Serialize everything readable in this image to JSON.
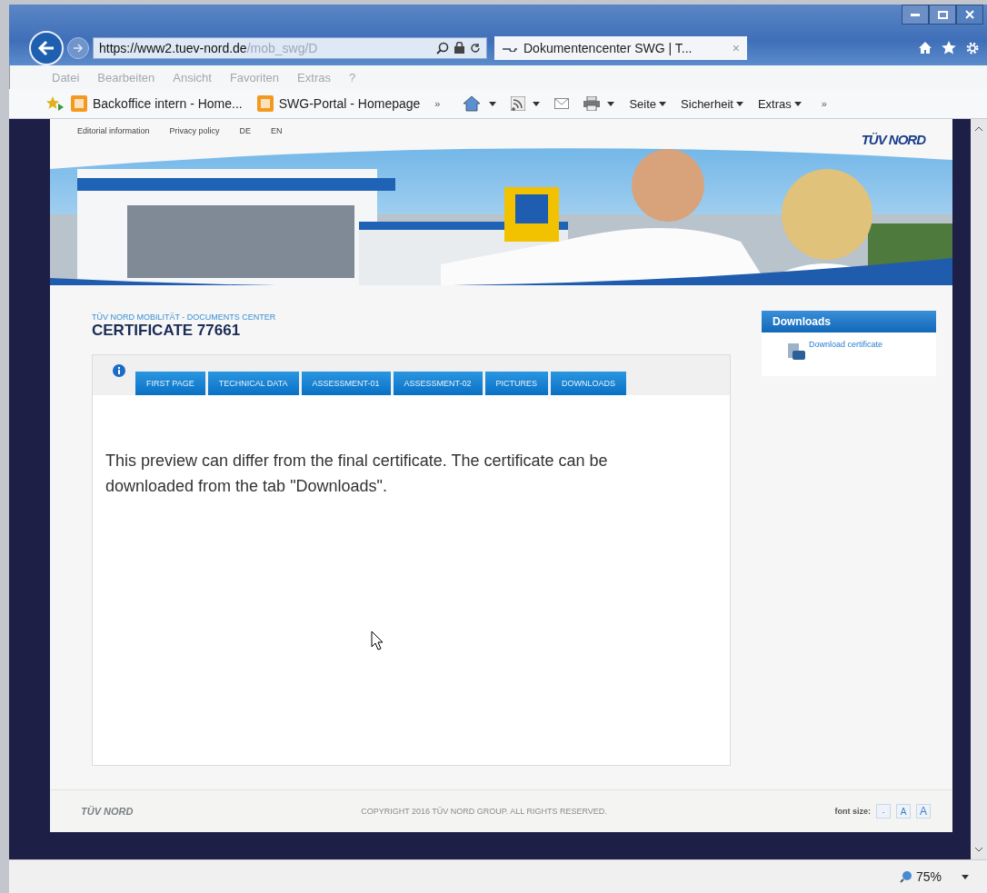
{
  "browser": {
    "address": {
      "scheme": "https://www2.",
      "domain": "tuev-nord.de",
      "path": "/mob_swg/D"
    },
    "tab": {
      "title": "Dokumentencenter SWG | T...",
      "close": "×"
    },
    "menu": [
      "Datei",
      "Bearbeiten",
      "Ansicht",
      "Favoriten",
      "Extras",
      "?"
    ],
    "favorites": [
      "Backoffice intern - Home...",
      "SWG-Portal - Homepage"
    ],
    "favorites_more": "»",
    "commands": [
      "Seite",
      "Sicherheit",
      "Extras"
    ],
    "commands_more": "»",
    "zoom": "75%"
  },
  "page": {
    "top_links": [
      "Editorial information",
      "Privacy policy",
      "DE",
      "EN"
    ],
    "logo": "TÜV NORD",
    "breadcrumb": "TÜV NORD MOBILITÄT - DOCUMENTS CENTER",
    "title": "CERTIFICATE 77661",
    "tabs": [
      {
        "kind": "info",
        "selected": true
      },
      {
        "kind": "text",
        "label": "FIRST PAGE",
        "selected": false
      },
      {
        "kind": "text",
        "label": "TECHNICAL DATA",
        "selected": false
      },
      {
        "kind": "text",
        "label": "ASSESSMENT-01",
        "selected": false
      },
      {
        "kind": "text",
        "label": "ASSESSMENT-02",
        "selected": false
      },
      {
        "kind": "text",
        "label": "PICTURES",
        "selected": false
      },
      {
        "kind": "text",
        "label": "DOWNLOADS",
        "selected": false
      }
    ],
    "notice": "This preview can differ from the final certificate. The certificate can be downloaded from the tab \"Downloads\".",
    "sidebar": {
      "title": "Downloads",
      "links": [
        "Download certificate"
      ]
    },
    "footer": {
      "logo": "TÜV NORD",
      "copyright": "COPYRIGHT 2016 TÜV NORD GROUP. ALL RIGHTS RESERVED.",
      "font_size_label": "font size:",
      "font_sizes": [
        "-",
        "A",
        "A"
      ]
    }
  }
}
